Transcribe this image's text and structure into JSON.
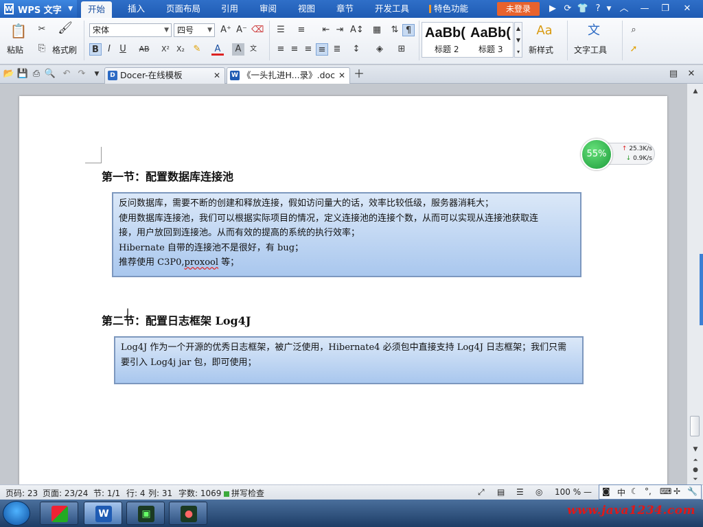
{
  "app": {
    "name": "WPS 文字"
  },
  "menu": {
    "items": [
      "开始",
      "插入",
      "页面布局",
      "引用",
      "审阅",
      "视图",
      "章节",
      "开发工具",
      "特色功能"
    ],
    "login": "未登录"
  },
  "ribbon": {
    "paste": "粘贴",
    "format_painter": "格式刷",
    "font_name": "宋体",
    "font_size": "四号",
    "styles": [
      {
        "sample": "AaBb(",
        "label": "标题 2"
      },
      {
        "sample": "AaBb(",
        "label": "标题 3"
      }
    ],
    "new_style": "新样式",
    "text_tools": "文字工具"
  },
  "tabs": [
    {
      "label": "Docer-在线模板",
      "active": false
    },
    {
      "label": "《一头扎进H...录》.doc",
      "active": true
    }
  ],
  "document": {
    "section1": {
      "heading": "第一节：配置数据库连接池",
      "lines": [
        "反问数据库，需要不断的创建和释放连接，假如访问量大的话，效率比较低级，服务器消耗大；",
        "使用数据库连接池，我们可以根据实际项目的情况，定义连接池的连接个数，从而可以实现从连接池获取连",
        "接，用户放回到连接池。从而有效的提高的系统的执行效率；",
        "Hibernate 自带的连接池不是很好，有 bug；"
      ],
      "last_line_prefix": "推荐使用 C3P0,",
      "last_line_misspelled": "proxool",
      "last_line_suffix": " 等；"
    },
    "section2": {
      "heading": "第二节：配置日志框架 Log4J",
      "lines": [
        "Log4J 作为一个开源的优秀日志框架，被广泛使用，Hibernate4 必须包中直接支持 Log4J 日志框架；我们只需",
        "要引入 Log4j jar 包，即可使用；"
      ]
    }
  },
  "net_widget": {
    "percent": "55%",
    "up": "25.3K/s",
    "down": "0.9K/s"
  },
  "status": {
    "page_no": "页码: 23",
    "page": "页面: 23/24",
    "section": "节: 1/1",
    "row": "行: 4",
    "col": "列: 31",
    "word_count": "字数: 1069",
    "spell": "拼写检查",
    "zoom": "100 %"
  },
  "ime": {
    "lang": "中"
  },
  "watermark": "www.java1234.com"
}
